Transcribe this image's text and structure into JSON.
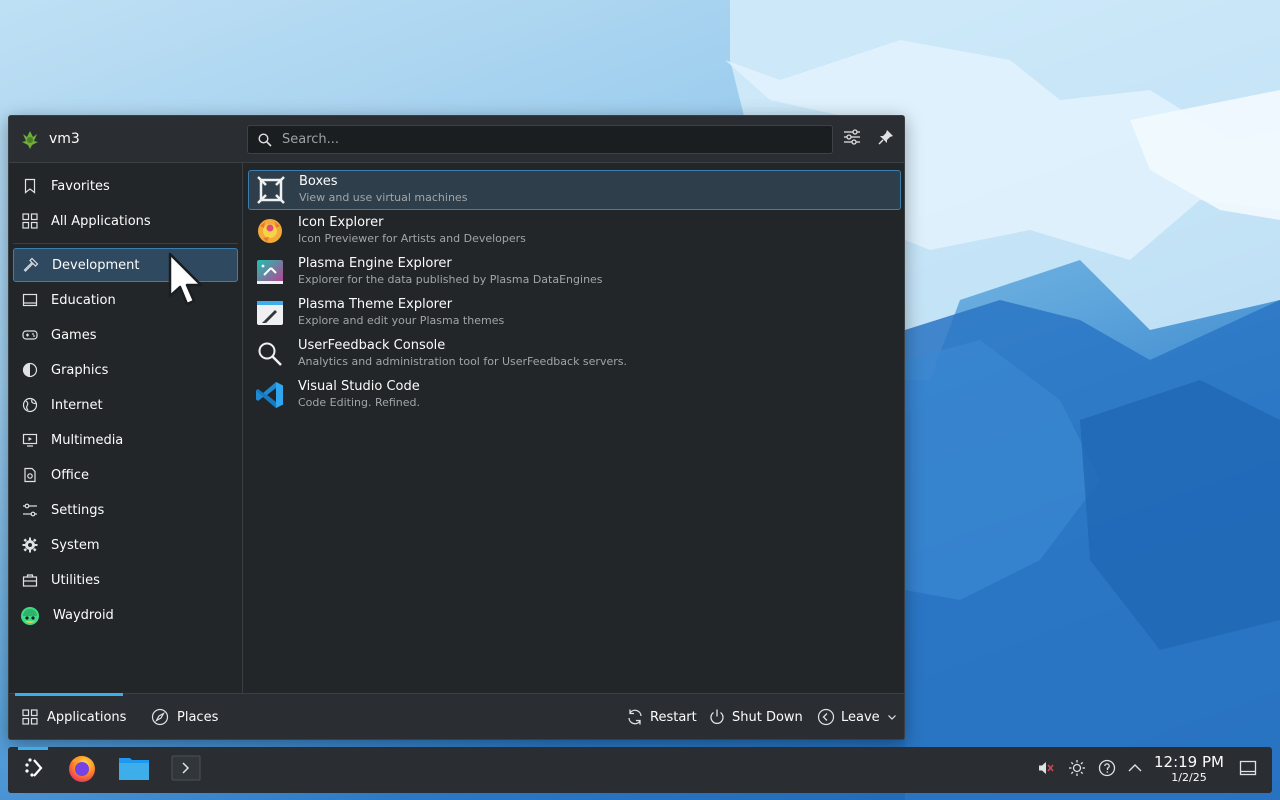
{
  "launcher": {
    "user_name": "vm3",
    "search_placeholder": "Search...",
    "sidebar": {
      "items": [
        {
          "label": "Favorites",
          "icon": "bookmark-icon"
        },
        {
          "label": "All Applications",
          "icon": "grid-icon"
        },
        {
          "label": "Development",
          "icon": "hammer-icon",
          "active": true
        },
        {
          "label": "Education",
          "icon": "education-icon"
        },
        {
          "label": "Games",
          "icon": "gamepad-icon"
        },
        {
          "label": "Graphics",
          "icon": "palette-icon"
        },
        {
          "label": "Internet",
          "icon": "globe-icon"
        },
        {
          "label": "Multimedia",
          "icon": "multimedia-icon"
        },
        {
          "label": "Office",
          "icon": "document-icon"
        },
        {
          "label": "Settings",
          "icon": "sliders-icon"
        },
        {
          "label": "System",
          "icon": "gear-icon"
        },
        {
          "label": "Utilities",
          "icon": "toolbox-icon"
        },
        {
          "label": "Waydroid",
          "icon": "waydroid-icon"
        }
      ]
    },
    "apps": [
      {
        "name": "Boxes",
        "description": "View and use virtual machines",
        "icon": "boxes-icon"
      },
      {
        "name": "Icon Explorer",
        "description": "Icon Previewer for Artists and Developers",
        "icon": "icon-explorer-icon"
      },
      {
        "name": "Plasma Engine Explorer",
        "description": "Explorer for the data published by Plasma DataEngines",
        "icon": "engine-explorer-icon"
      },
      {
        "name": "Plasma Theme Explorer",
        "description": "Explore and edit your Plasma themes",
        "icon": "theme-explorer-icon"
      },
      {
        "name": "UserFeedback Console",
        "description": "Analytics and administration tool for UserFeedback servers.",
        "icon": "magnifier-icon"
      },
      {
        "name": "Visual Studio Code",
        "description": "Code Editing. Refined.",
        "icon": "vscode-icon"
      }
    ],
    "footer": {
      "applications_tab": "Applications",
      "places_tab": "Places",
      "restart": "Restart",
      "shut_down": "Shut Down",
      "leave": "Leave"
    }
  },
  "taskbar": {
    "time": "12:19 PM",
    "date": "1/2/25",
    "tasks": [
      "application-launcher-icon",
      "firefox-icon",
      "file-manager-icon",
      "terminal-icon"
    ],
    "tray": [
      "volume-muted-icon",
      "brightness-icon",
      "help-icon",
      "chevron-up-icon",
      "show-desktop-icon"
    ]
  },
  "colors": {
    "accent": "#3daee9",
    "panel_bg": "#232629",
    "header_bg": "#2a2e32",
    "active_bg": "#2f4a60"
  }
}
